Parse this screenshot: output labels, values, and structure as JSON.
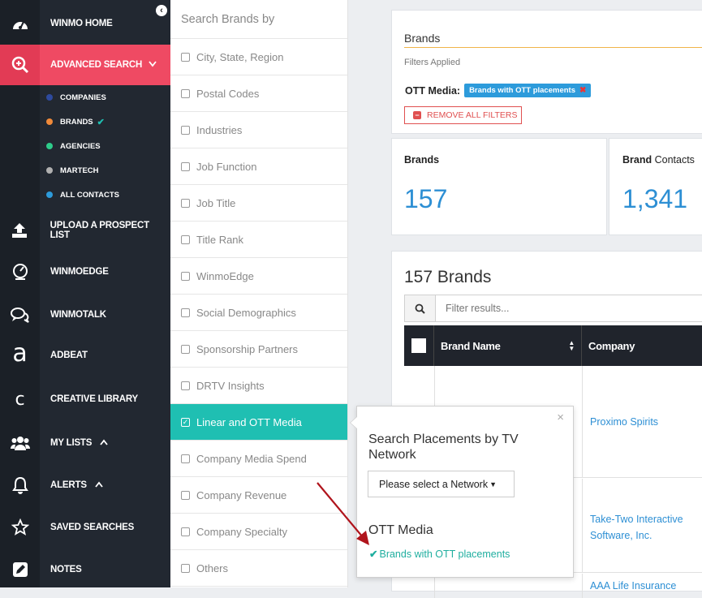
{
  "nav": {
    "items": [
      {
        "label": "WINMO HOME",
        "icon": "dashboard-icon"
      },
      {
        "label": "ADVANCED SEARCH",
        "icon": "search-plus-icon"
      },
      {
        "label": "UPLOAD A PROSPECT LIST",
        "icon": "upload-icon"
      },
      {
        "label": "WINMOEDGE",
        "icon": "gauge-icon"
      },
      {
        "label": "WINMOTALK",
        "icon": "chat-icon"
      },
      {
        "label": "ADBEAT",
        "icon": "adbeat-icon",
        "glyph": "a"
      },
      {
        "label": "CREATIVE LIBRARY",
        "icon": "creative-icon",
        "glyph": "c"
      },
      {
        "label": "MY LISTS",
        "icon": "users-icon"
      },
      {
        "label": "ALERTS",
        "icon": "bell-icon"
      },
      {
        "label": "SAVED SEARCHES",
        "icon": "star-icon"
      },
      {
        "label": "NOTES",
        "icon": "pencil-icon"
      }
    ],
    "subitems": [
      {
        "label": "COMPANIES",
        "color": "#2e4a9e"
      },
      {
        "label": "BRANDS",
        "color": "#f08a3a"
      },
      {
        "label": "AGENCIES",
        "color": "#2ecc8a"
      },
      {
        "label": "MARTECH",
        "color": "#b0b0b0"
      },
      {
        "label": "ALL CONTACTS",
        "color": "#2d9bdb"
      }
    ]
  },
  "facets": {
    "heading": "Search Brands by",
    "items": [
      "City, State, Region",
      "Postal Codes",
      "Industries",
      "Job Function",
      "Job Title",
      "Title Rank",
      "WinmoEdge",
      "Social Demographics",
      "Sponsorship Partners",
      "DRTV Insights",
      "Linear and OTT Media",
      "Company Media Spend",
      "Company Revenue",
      "Company Specialty",
      "Others"
    ]
  },
  "filters": {
    "title": "Brands",
    "applied_label": "Filters Applied",
    "group_label": "OTT Media:",
    "tag": "Brands with OTT placements",
    "remove_all": "REMOVE ALL FILTERS"
  },
  "stats": [
    {
      "label_bold": "Brands",
      "label_rest": "",
      "value": "157"
    },
    {
      "label_bold": "Brand",
      "label_rest": " Contacts",
      "value": "1,341"
    }
  ],
  "results": {
    "title": "157 Brands",
    "filter_placeholder": "Filter results...",
    "columns": [
      "Brand Name",
      "Company"
    ],
    "companies": [
      "Proximo Spirits",
      "Take-Two Interactive Software, Inc.",
      "AAA Life Insurance"
    ]
  },
  "popover": {
    "title": "Search Placements by TV Network",
    "select_value": "Please select a Network",
    "section": "OTT Media",
    "option": "Brands with OTT placements"
  },
  "colors": {
    "accent": "#ef4a63",
    "teal": "#1fbfb2",
    "blue": "#2d8fd4",
    "navy": "#20242c"
  }
}
